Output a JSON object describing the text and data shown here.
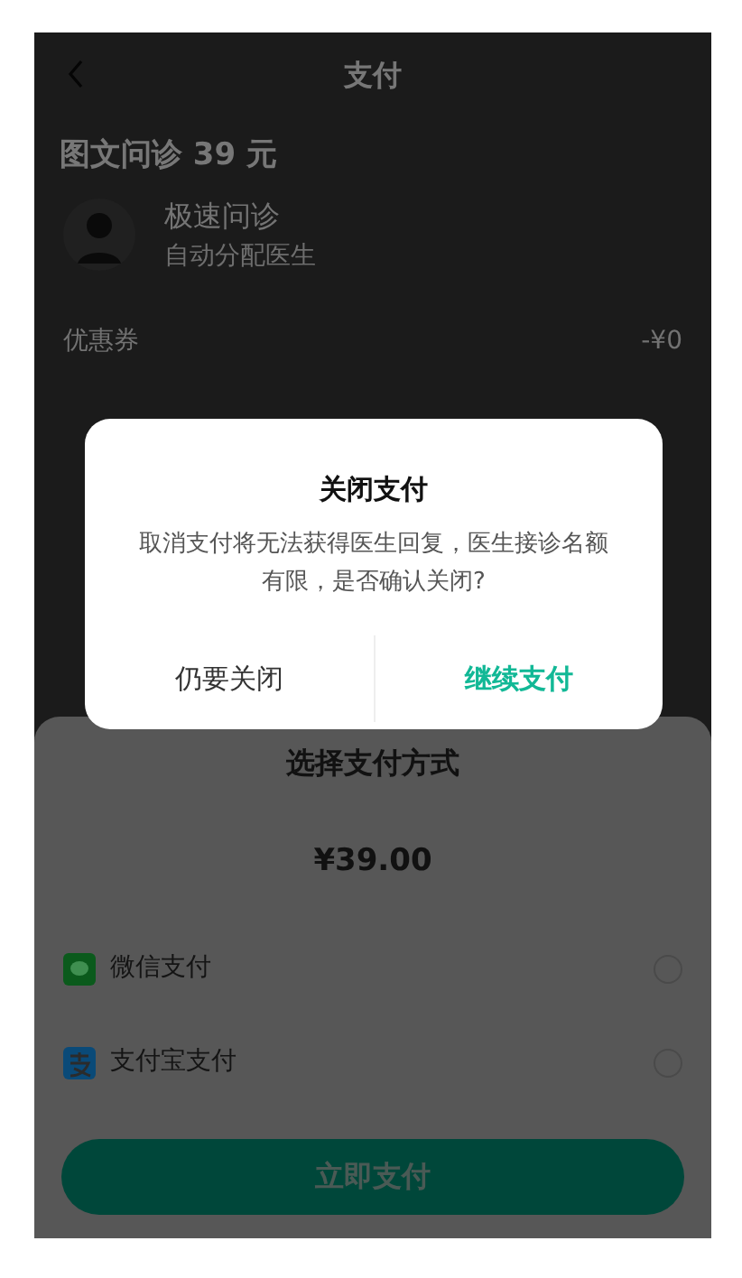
{
  "header": {
    "title": "支付"
  },
  "service": {
    "title": "图文问诊 39 元",
    "name": "极速问诊",
    "subtitle": "自动分配医生"
  },
  "coupon": {
    "label": "优惠券",
    "value": "-¥0"
  },
  "dialog": {
    "title": "关闭支付",
    "message": "取消支付将无法获得医生回复，医生接诊名额有限，是否确认关闭?",
    "buttons": [
      {
        "label": "仍要关闭",
        "kind": "cancel"
      },
      {
        "label": "继续支付",
        "kind": "confirm"
      }
    ]
  },
  "sheet": {
    "title": "选择支付方式",
    "amount": "¥39.00",
    "methods": [
      {
        "label": "微信支付",
        "kind": "wechat",
        "selected": false
      },
      {
        "label": "支付宝支付",
        "kind": "alipay",
        "selected": false
      }
    ],
    "submit": "立即支付"
  }
}
